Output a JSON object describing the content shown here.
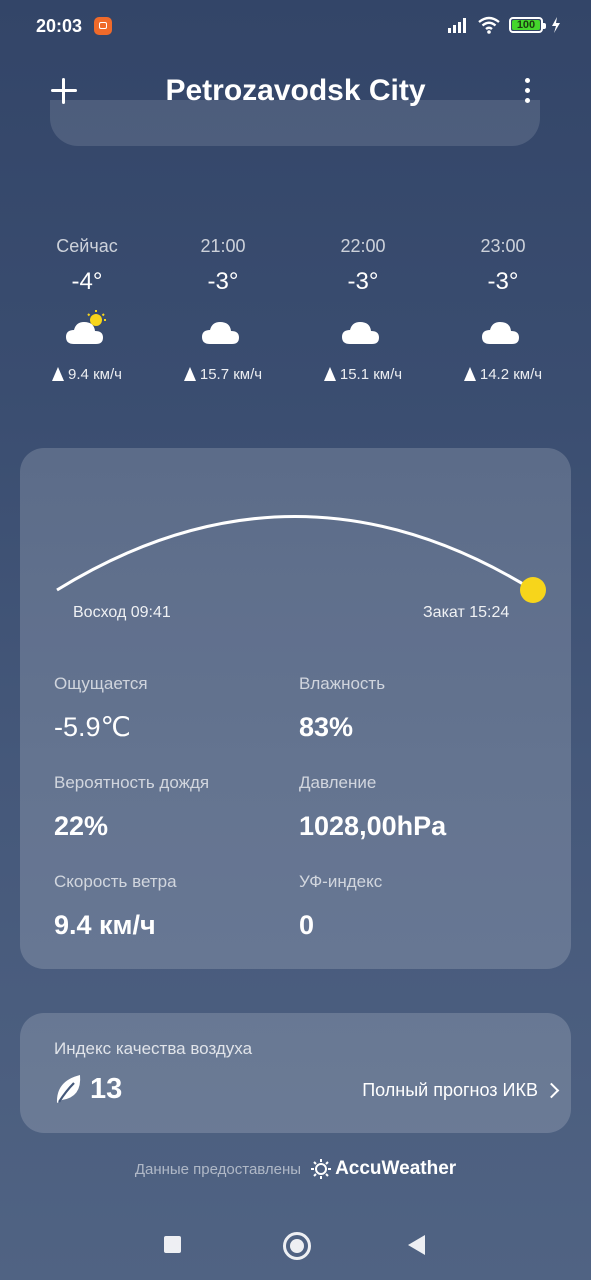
{
  "status": {
    "time": "20:03",
    "battery": "100"
  },
  "header": {
    "title": "Petrozavodsk City"
  },
  "hourly": [
    {
      "time": "Сейчас",
      "temp": "-4°",
      "icon": "cloud-sun-icon",
      "wind": "9.4 км/ч"
    },
    {
      "time": "21:00",
      "temp": "-3°",
      "icon": "cloud-icon",
      "wind": "15.7 км/ч"
    },
    {
      "time": "22:00",
      "temp": "-3°",
      "icon": "cloud-icon",
      "wind": "15.1 км/ч"
    },
    {
      "time": "23:00",
      "temp": "-3°",
      "icon": "cloud-icon",
      "wind": "14.2 км/ч"
    }
  ],
  "sun": {
    "sunrise": "Восход 09:41",
    "sunset": "Закат 15:24",
    "color": "#f7d51b"
  },
  "details": {
    "feels_label": "Ощущается",
    "feels_value": "-5.9℃",
    "humidity_label": "Влажность",
    "humidity_value": "83%",
    "rain_label": "Вероятность дождя",
    "rain_value": "22%",
    "pressure_label": "Давление",
    "pressure_value": "1028,00hPa",
    "wind_label": "Скорость ветра",
    "wind_value": "9.4 км/ч",
    "uv_label": "УФ-индекс",
    "uv_value": "0"
  },
  "aqi": {
    "label": "Индекс качества воздуха",
    "value": "13",
    "link": "Полный прогноз ИКВ"
  },
  "footer": {
    "provided_by": "Данные предоставлены",
    "brand": "AccuWeather"
  }
}
